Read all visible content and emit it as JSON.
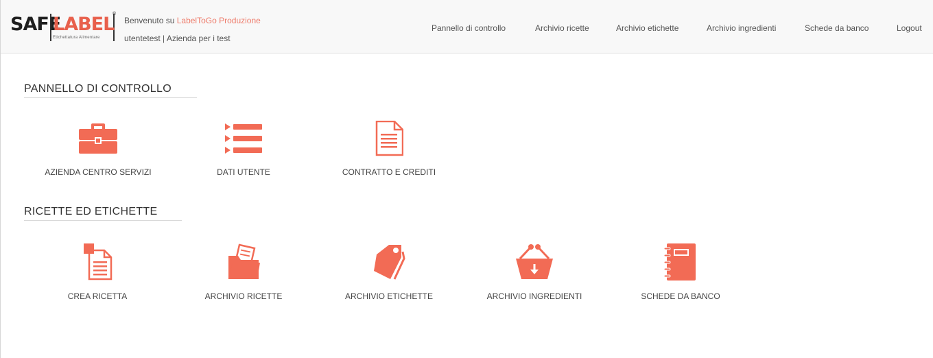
{
  "header": {
    "logo": {
      "safe": "SAFE",
      "label": "LABEL",
      "reg": "®",
      "subtitle": "Etichettatura Alimentare"
    },
    "welcome_prefix": "Benvenuto su ",
    "welcome_app": "LabelToGo Produzione",
    "user_line": "utentetest | Azienda per i test",
    "nav": [
      "Pannello di controllo",
      "Archivio ricette",
      "Archivio etichette",
      "Archivio ingredienti",
      "Schede da banco",
      "Logout"
    ]
  },
  "sections": [
    {
      "title": "PANNELLO DI CONTROLLO",
      "tiles": [
        {
          "label": "AZIENDA CENTRO SERVIZI",
          "icon": "briefcase-icon"
        },
        {
          "label": "DATI UTENTE",
          "icon": "list-icon"
        },
        {
          "label": "CONTRATTO E CREDITI",
          "icon": "document-icon"
        }
      ]
    },
    {
      "title": "RICETTE ED ETICHETTE",
      "tiles": [
        {
          "label": "CREA RICETTA",
          "icon": "new-document-icon"
        },
        {
          "label": "ARCHIVIO RICETTE",
          "icon": "folder-icon"
        },
        {
          "label": "ARCHIVIO ETICHETTE",
          "icon": "tags-icon"
        },
        {
          "label": "ARCHIVIO INGREDIENTI",
          "icon": "basket-icon"
        },
        {
          "label": "SCHEDE DA BANCO",
          "icon": "notebook-icon"
        }
      ]
    }
  ],
  "colors": {
    "accent": "#f26b55",
    "text": "#444444",
    "header_bg": "#f8f8f8"
  }
}
